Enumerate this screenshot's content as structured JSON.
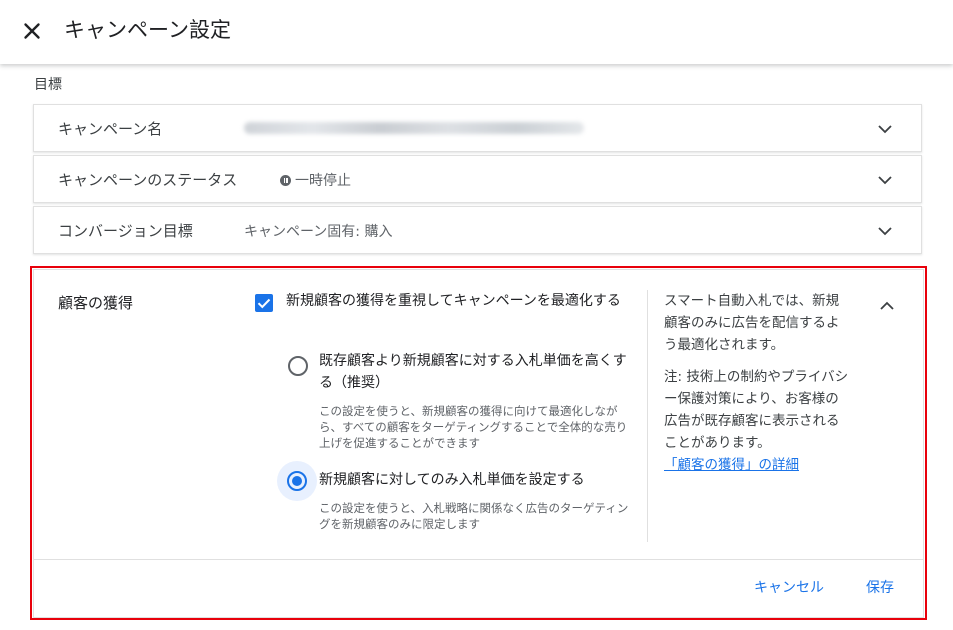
{
  "header": {
    "title": "キャンペーン設定",
    "close_icon": "close-icon"
  },
  "section": {
    "label": "目標"
  },
  "rows": [
    {
      "label": "キャンペーン名",
      "value": "",
      "value_redacted": true
    },
    {
      "label": "キャンペーンのステータス",
      "value": "一時停止",
      "status_icon": "pause-icon"
    },
    {
      "label": "コンバージョン目標",
      "value": "キャンペーン固有: 購入"
    }
  ],
  "customer_acquisition": {
    "title": "顧客の獲得",
    "checkbox_label": "新規顧客の獲得を重視してキャンペーンを最適化する",
    "checkbox_checked": true,
    "options": [
      {
        "title": "既存顧客より新規顧客に対する入札単価を高くする（推奨）",
        "description": "この設定を使うと、新規顧客の獲得に向けて最適化しながら、すべての顧客をターゲティングすることで全体的な売り上げを促進することができます",
        "selected": false
      },
      {
        "title": "新規顧客に対してのみ入札単価を設定する",
        "description": "この設定を使うと、入札戦略に関係なく広告のターゲティングを新規顧客のみに限定します",
        "selected": true
      }
    ],
    "help_text_1": "スマート自動入札では、新規顧客のみに広告を配信するよう最適化されます。",
    "help_text_2": "注: 技術上の制約やプライバシー保護対策により、お客様の広告が既存顧客に表示されることがあります。",
    "help_link": "「顧客の獲得」の詳細",
    "cancel_label": "キャンセル",
    "save_label": "保存"
  },
  "colors": {
    "accent": "#1a73e8",
    "highlight_border": "#e8000b"
  }
}
